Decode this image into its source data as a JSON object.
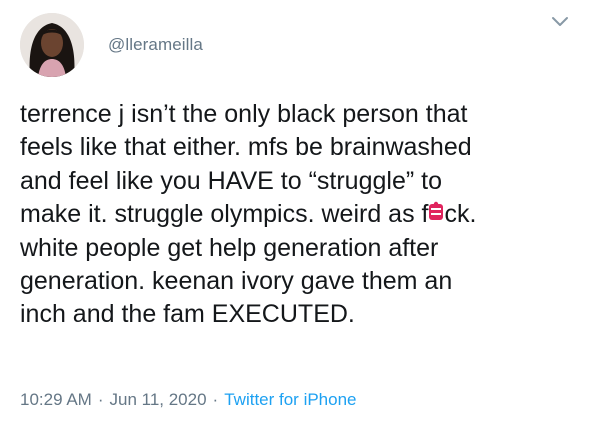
{
  "user": {
    "handle": "@llerameilla",
    "avatar_icon": "profile-photo"
  },
  "tweet": {
    "lines": [
      "terrence j isn’t the only black person that",
      "feels like that either. mfs be brainwashed",
      "and feel like you HAVE to “struggle” to",
      "make it. struggle olympics. weird as f",
      "ck.",
      "white people get help generation after",
      "generation. keenan ivory gave them an",
      "inch and the fam EXECUTED."
    ],
    "censor_icon": "pink-censor-emoji",
    "censor_color": "#e0245e"
  },
  "meta": {
    "time": "10:29 AM",
    "separator": "·",
    "date": "Jun 11, 2020",
    "source": "Twitter for iPhone",
    "source_color": "#1da1f2"
  },
  "menu": {
    "icon": "chevron-down-icon"
  }
}
